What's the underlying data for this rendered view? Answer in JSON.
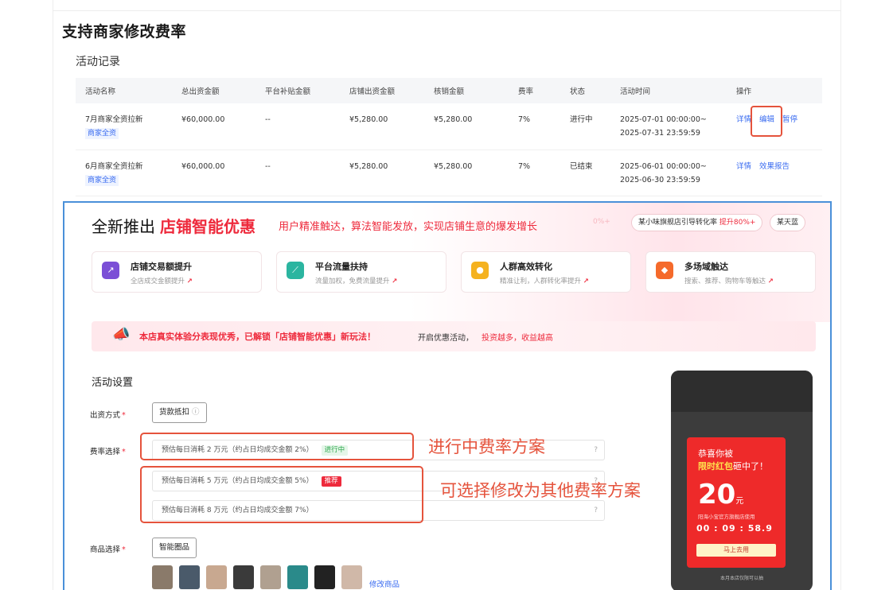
{
  "page_title": "支持商家修改费率",
  "section_title": "活动记录",
  "table": {
    "headers": [
      "活动名称",
      "总出资金额",
      "平台补贴金额",
      "店铺出资金额",
      "核销金额",
      "费率",
      "状态",
      "活动时间",
      "操作"
    ],
    "rows": [
      {
        "name": "7月商家全资拉新",
        "tag": "商家全资",
        "total": "¥60,000.00",
        "subsidy": "--",
        "store": "¥5,280.00",
        "verified": "¥5,280.00",
        "rate": "7%",
        "status": "进行中",
        "time_start": "2025-07-01 00:00:00~",
        "time_end": "2025-07-31 23:59:59",
        "actions": [
          "详情",
          "编辑",
          "暂停"
        ]
      },
      {
        "name": "6月商家全资拉新",
        "tag": "商家全资",
        "total": "¥60,000.00",
        "subsidy": "--",
        "store": "¥5,280.00",
        "verified": "¥5,280.00",
        "rate": "7%",
        "status": "已结束",
        "time_start": "2025-06-01 00:00:00~",
        "time_end": "2025-06-30 23:59:59",
        "actions": [
          "详情",
          "效果报告"
        ]
      }
    ]
  },
  "promo": {
    "title_prefix": "全新推出",
    "title_highlight": "店铺智能优惠",
    "subtitle": "用户精准触达，算法智能发放，实现店铺生意的爆发增长",
    "faded_text": "0%+",
    "chip1_text": "某小味旗舰店引导转化率",
    "chip1_highlight": "提升80%+",
    "chip2_text": "某天蓝",
    "features": [
      {
        "title": "店铺交易额提升",
        "desc": "全店成交金额提升",
        "icon": "chart-up-icon",
        "color": "#7b4fd6"
      },
      {
        "title": "平台流量扶持",
        "desc": "流量加权，免费流量提升",
        "icon": "traffic-icon",
        "color": "#2bb5a0"
      },
      {
        "title": "人群高效转化",
        "desc": "精准让利，人群转化率提升",
        "icon": "crowd-icon",
        "color": "#f5b21f"
      },
      {
        "title": "多场域触达",
        "desc": "搜索、推荐、购物车等触达",
        "icon": "multi-scene-icon",
        "color": "#f56a2b"
      }
    ],
    "banner": {
      "main": "本店真实体验分表现优秀，已解锁「店铺智能优惠」新玩法！",
      "mid": "开启优惠活动，",
      "tail": "投资越多，收益越高"
    },
    "settings_title": "活动设置",
    "funding_label": "出资方式",
    "funding_button": "货款抵扣",
    "rate_label": "费率选择",
    "rate_options": [
      {
        "text": "预估每日消耗 2 万元（约占日均成交金额 2%）",
        "badge": "进行中"
      },
      {
        "text": "预估每日消耗 5 万元（约占日均成交金额 5%）",
        "badge": "推荐"
      },
      {
        "text": "预估每日消耗 8 万元（约占日均成交金额 7%）",
        "badge": ""
      }
    ],
    "goods_label": "商品选择",
    "goods_button": "智能圈品",
    "modify_goods": "修改商品",
    "thumb_colors": [
      "#8a7a6a",
      "#4a5a6a",
      "#c8a890",
      "#3a3a3a",
      "#b0a090",
      "#2a8a8a",
      "#222222",
      "#d0b8a8"
    ]
  },
  "annotations": {
    "current_rate": "进行中费率方案",
    "other_rates": "可选择修改为其他费率方案"
  },
  "phone": {
    "congrats": "恭喜你被",
    "hit_highlight": "限时红包",
    "hit_tail": "砸中了！",
    "amount": "20",
    "unit": "元",
    "store_note": "阳海小宝官方旗舰店使用",
    "countdown": "00 : 09 : 58.9",
    "cta": "马上去用",
    "footer": "本月本店仅限可以抽"
  },
  "colors": {
    "accent_red": "#ee2a3c",
    "link_blue": "#3b6cf0",
    "frame_blue": "#4a90d9",
    "annotation_red": "#e5533c"
  }
}
